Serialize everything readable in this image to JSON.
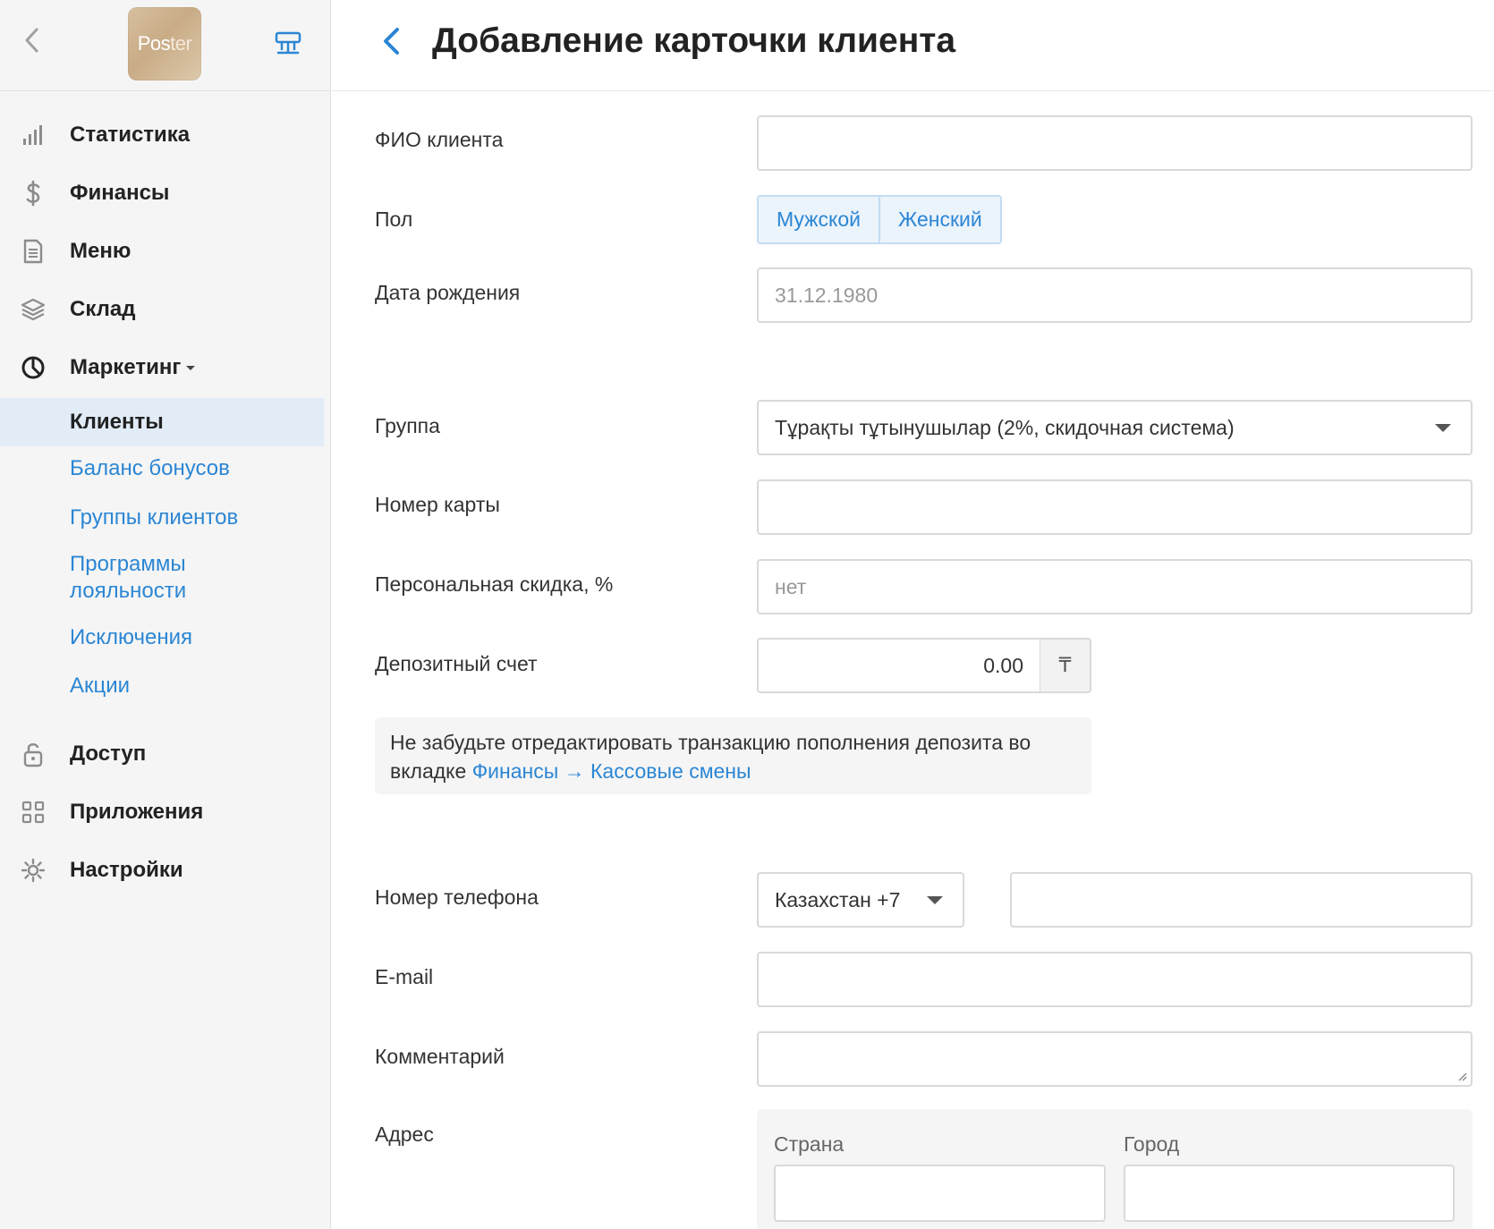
{
  "app": {
    "logo_text_a": "Pos",
    "logo_text_b": "ter"
  },
  "sidebar": {
    "items": [
      {
        "label": "Статистика",
        "icon": "bar-chart-icon"
      },
      {
        "label": "Финансы",
        "icon": "dollar-icon"
      },
      {
        "label": "Меню",
        "icon": "document-icon"
      },
      {
        "label": "Склад",
        "icon": "layers-icon"
      },
      {
        "label": "Маркетинг",
        "icon": "marketing-icon"
      }
    ],
    "marketing_sub": [
      {
        "label": "Клиенты",
        "active": true
      },
      {
        "label": "Баланс бонусов"
      },
      {
        "label": "Группы клиентов"
      },
      {
        "label": "Программы лояльности"
      },
      {
        "label": "Исключения"
      },
      {
        "label": "Акции"
      }
    ],
    "bottom_items": [
      {
        "label": "Доступ",
        "icon": "lock-icon"
      },
      {
        "label": "Приложения",
        "icon": "apps-grid-icon"
      },
      {
        "label": "Настройки",
        "icon": "gear-icon"
      }
    ]
  },
  "header": {
    "title": "Добавление карточки клиента"
  },
  "form": {
    "name": {
      "label": "ФИО клиента",
      "value": ""
    },
    "gender": {
      "label": "Пол",
      "options": [
        "Мужской",
        "Женский"
      ]
    },
    "birthday": {
      "label": "Дата рождения",
      "placeholder": "31.12.1980"
    },
    "group": {
      "label": "Группа",
      "value": "Тұрақты тұтынушылар (2%, скидочная система)"
    },
    "card": {
      "label": "Номер карты",
      "value": ""
    },
    "discount": {
      "label": "Персональная скидка, %",
      "placeholder": "нет"
    },
    "deposit": {
      "label": "Депозитный счет",
      "value": "0.00",
      "currency": "₸"
    },
    "note": {
      "text": "Не забудьте отредактировать транзакцию пополнения депозита во вкладке",
      "link": "Финансы → Кассовые смены"
    },
    "phone": {
      "label": "Номер телефона",
      "country": "Казахстан +7",
      "value": ""
    },
    "email": {
      "label": "E-mail",
      "value": ""
    },
    "comment": {
      "label": "Комментарий",
      "value": ""
    },
    "address": {
      "label": "Адрес",
      "country_label": "Страна",
      "city_label": "Город"
    }
  },
  "colors": {
    "accent": "#2b86d4",
    "active_bg": "#e1ecf7",
    "sidebar_bg": "#f5f5f5"
  }
}
